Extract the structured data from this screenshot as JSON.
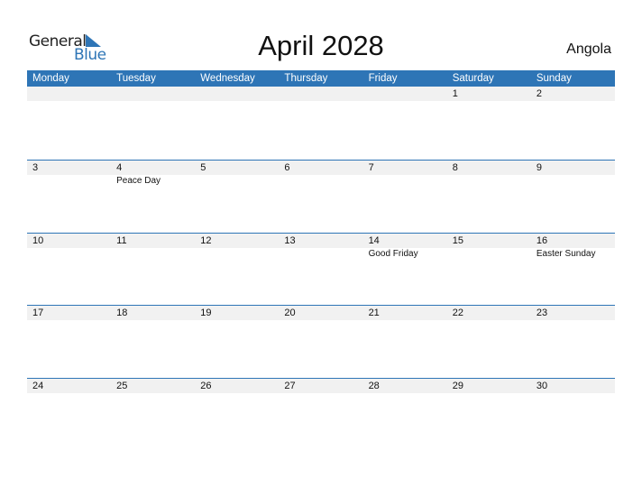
{
  "logo": {
    "line1": "General",
    "line2": "Blue"
  },
  "title": "April 2028",
  "country": "Angola",
  "colors": {
    "accent": "#2e75b6",
    "strip": "#f1f1f1"
  },
  "weekdays": [
    "Monday",
    "Tuesday",
    "Wednesday",
    "Thursday",
    "Friday",
    "Saturday",
    "Sunday"
  ],
  "weeks": [
    [
      {
        "d": ""
      },
      {
        "d": ""
      },
      {
        "d": ""
      },
      {
        "d": ""
      },
      {
        "d": ""
      },
      {
        "d": "1"
      },
      {
        "d": "2"
      }
    ],
    [
      {
        "d": "3"
      },
      {
        "d": "4",
        "h": "Peace Day"
      },
      {
        "d": "5"
      },
      {
        "d": "6"
      },
      {
        "d": "7"
      },
      {
        "d": "8"
      },
      {
        "d": "9"
      }
    ],
    [
      {
        "d": "10"
      },
      {
        "d": "11"
      },
      {
        "d": "12"
      },
      {
        "d": "13"
      },
      {
        "d": "14",
        "h": "Good Friday"
      },
      {
        "d": "15"
      },
      {
        "d": "16",
        "h": "Easter Sunday"
      }
    ],
    [
      {
        "d": "17"
      },
      {
        "d": "18"
      },
      {
        "d": "19"
      },
      {
        "d": "20"
      },
      {
        "d": "21"
      },
      {
        "d": "22"
      },
      {
        "d": "23"
      }
    ],
    [
      {
        "d": "24"
      },
      {
        "d": "25"
      },
      {
        "d": "26"
      },
      {
        "d": "27"
      },
      {
        "d": "28"
      },
      {
        "d": "29"
      },
      {
        "d": "30"
      }
    ]
  ]
}
